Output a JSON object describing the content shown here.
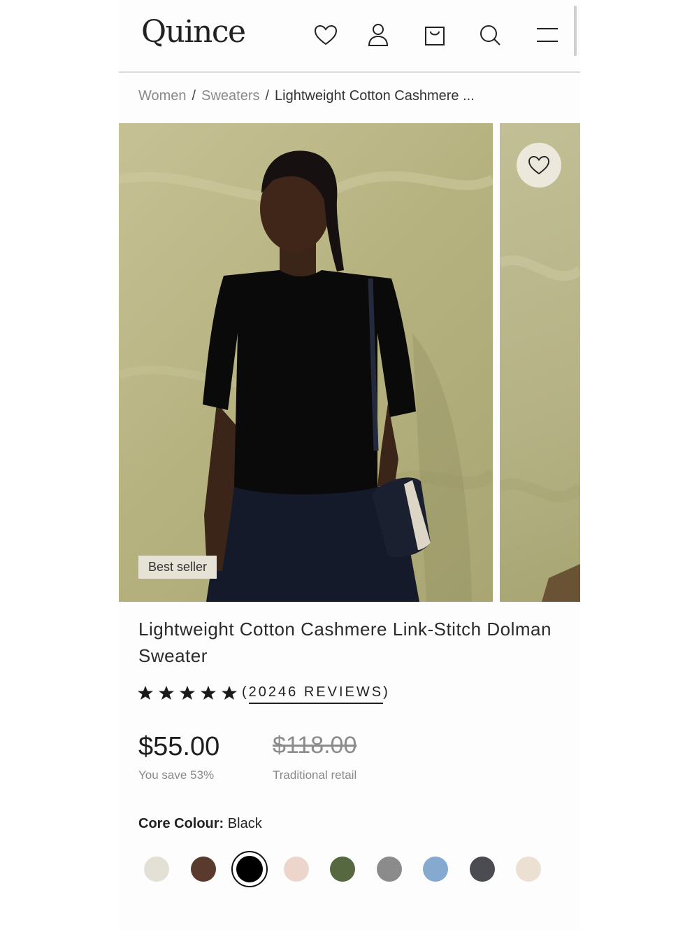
{
  "header": {
    "logo": "Quince",
    "icons": [
      "heart-icon",
      "account-icon",
      "cart-icon",
      "search-icon",
      "menu-icon"
    ]
  },
  "breadcrumb": {
    "items": [
      "Women",
      "Sweaters"
    ],
    "current": "Lightweight Cotton Cashmere ...",
    "separator": "/"
  },
  "gallery": {
    "badge": "Best seller"
  },
  "product": {
    "title": "Lightweight Cotton Cashmere Link-Stitch Dolman Sweater",
    "rating": 5,
    "reviews_prefix": "(",
    "reviews_text": "20246 REVIEWS",
    "reviews_suffix": ")",
    "price": "$55.00",
    "savings": "You save 53%",
    "retail_price": "$118.00",
    "retail_label": "Traditional retail"
  },
  "colour": {
    "label": "Core Colour:",
    "selected": "Black",
    "swatches": [
      {
        "color": "#e3e0d6",
        "selected": false
      },
      {
        "color": "#5a3a2c",
        "selected": false
      },
      {
        "color": "#000000",
        "selected": true
      },
      {
        "color": "#ecd6cb",
        "selected": false
      },
      {
        "color": "#55683f",
        "selected": false
      },
      {
        "color": "#8b8b8b",
        "selected": false
      },
      {
        "color": "#86a9cf",
        "selected": false
      },
      {
        "color": "#4a4c52",
        "selected": false
      },
      {
        "color": "#ece0d2",
        "selected": false
      }
    ]
  }
}
